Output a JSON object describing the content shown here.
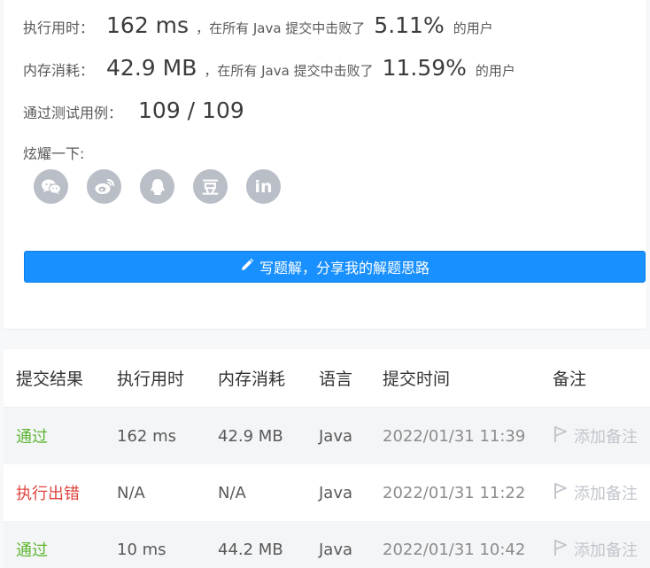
{
  "stats": {
    "runtime": {
      "label": "执行用时：",
      "value": "162 ms",
      "beat_text": "，在所有 Java 提交中击败了",
      "percent": "5.11%",
      "suffix": "的用户"
    },
    "memory": {
      "label": "内存消耗：",
      "value": "42.9 MB",
      "beat_text": "，在所有 Java 提交中击败了",
      "percent": "11.59%",
      "suffix": "的用户"
    },
    "tests": {
      "label": "通过测试用例：",
      "value": "109 / 109"
    }
  },
  "share": {
    "label": "炫耀一下:",
    "icons": [
      "wechat-icon",
      "weibo-icon",
      "qq-icon",
      "douban-icon",
      "linkedin-icon"
    ],
    "douban_glyph": "豆",
    "linkedin_glyph": "in"
  },
  "write_button": {
    "label": "写题解，分享我的解题思路",
    "icon": "pencil-icon"
  },
  "table": {
    "headers": [
      "提交结果",
      "执行用时",
      "内存消耗",
      "语言",
      "提交时间",
      "备注"
    ],
    "rows": [
      {
        "status": "通过",
        "status_type": "pass",
        "runtime": "162 ms",
        "memory": "42.9 MB",
        "language": "Java",
        "time": "2022/01/31 11:39",
        "note": "添加备注"
      },
      {
        "status": "执行出错",
        "status_type": "error",
        "runtime": "N/A",
        "memory": "N/A",
        "language": "Java",
        "time": "2022/01/31 11:22",
        "note": "添加备注"
      },
      {
        "status": "通过",
        "status_type": "pass",
        "runtime": "10 ms",
        "memory": "44.2 MB",
        "language": "Java",
        "time": "2022/01/31 10:42",
        "note": "添加备注"
      }
    ]
  },
  "colors": {
    "primary": "#1890ff",
    "pass": "#5cb531",
    "error": "#e0443f",
    "icon_bg": "#b9bec7"
  }
}
